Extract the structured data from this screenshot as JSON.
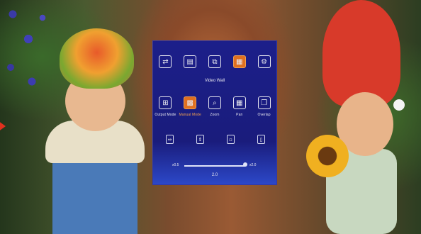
{
  "osd": {
    "top_icons": [
      {
        "icon": "input-source-icon",
        "glyph": "⇄"
      },
      {
        "icon": "display-settings-icon",
        "glyph": "▤"
      },
      {
        "icon": "pip-icon",
        "glyph": "⧉"
      },
      {
        "icon": "video-wall-icon",
        "glyph": "▦"
      },
      {
        "icon": "gear-icon",
        "glyph": "⚙"
      }
    ],
    "title": "Video Wall",
    "modes": [
      {
        "label": "Output Mode",
        "icon": "output-mode-icon",
        "glyph": "⊞",
        "active": false
      },
      {
        "label": "Manual Mode",
        "icon": "manual-mode-icon",
        "glyph": "▩",
        "active": true
      },
      {
        "label": "Zoom",
        "icon": "zoom-icon",
        "glyph": "⌕",
        "active": false
      },
      {
        "label": "Pan",
        "icon": "pan-icon",
        "glyph": "▦",
        "active": false
      },
      {
        "label": "Overlap",
        "icon": "overlap-icon",
        "glyph": "❐",
        "active": false
      }
    ],
    "adjust_icons": [
      {
        "icon": "horizontal-stretch-icon",
        "glyph": "⇔"
      },
      {
        "icon": "vertical-stretch-icon",
        "glyph": "⇕"
      },
      {
        "icon": "position-icon",
        "glyph": "▫"
      },
      {
        "icon": "size-icon",
        "glyph": "▯"
      }
    ],
    "slider": {
      "min_label": "x0.5",
      "max_label": "x2.0",
      "value_label": "2.0",
      "fraction": 1.0
    }
  }
}
